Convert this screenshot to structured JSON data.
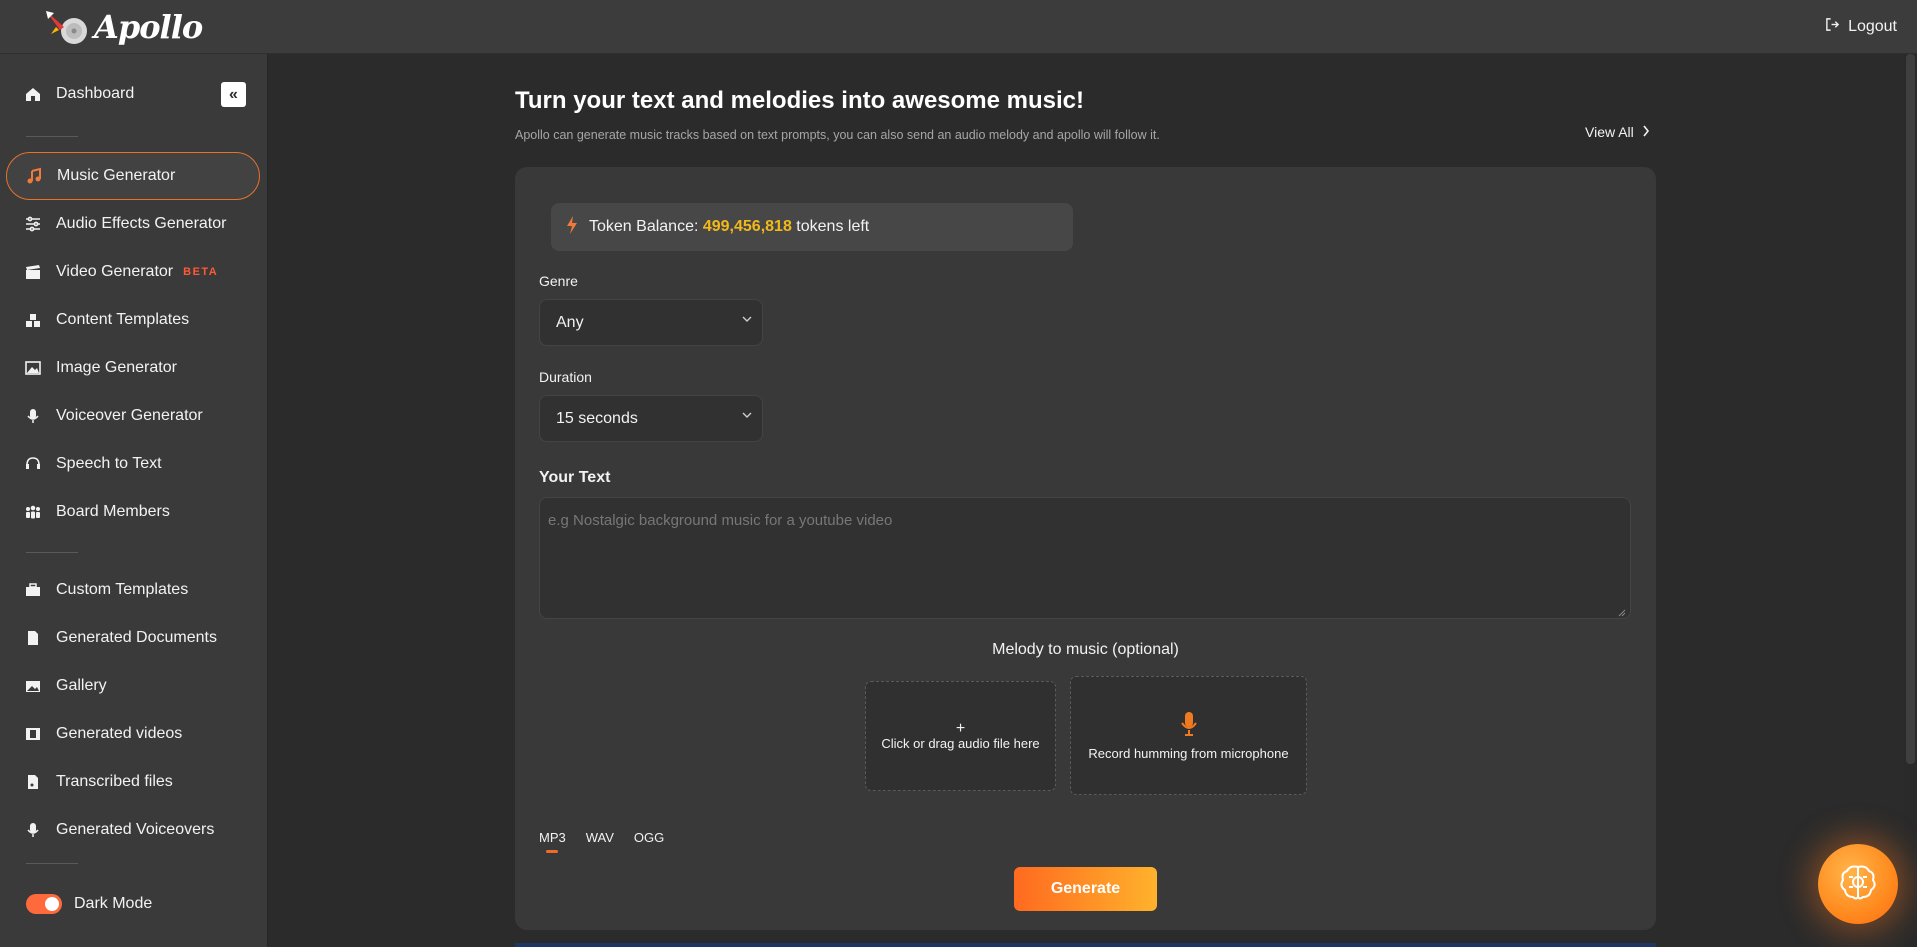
{
  "app": {
    "logo_text": "Apollo",
    "logout_label": "Logout"
  },
  "colors": {
    "accent": "#ff6a3d",
    "token_highlight": "#f2b91b",
    "beta": "#ff5a36",
    "background": "#2b2b2b"
  },
  "sidebar": {
    "collapse_glyph": "«",
    "items": [
      {
        "label": "Dashboard",
        "icon": "home-icon"
      },
      {
        "label": "Music Generator",
        "icon": "music-note-icon",
        "active": true
      },
      {
        "label": "Audio Effects Generator",
        "icon": "sliders-icon"
      },
      {
        "label": "Video Generator",
        "icon": "clapperboard-icon",
        "badge": "BETA"
      },
      {
        "label": "Content Templates",
        "icon": "blocks-icon"
      },
      {
        "label": "Image Generator",
        "icon": "image-icon"
      },
      {
        "label": "Voiceover Generator",
        "icon": "microphone-icon"
      },
      {
        "label": "Speech to Text",
        "icon": "headset-icon"
      },
      {
        "label": "Board Members",
        "icon": "people-icon"
      },
      {
        "label": "Custom Templates",
        "icon": "toolbox-icon"
      },
      {
        "label": "Generated Documents",
        "icon": "document-icon"
      },
      {
        "label": "Gallery",
        "icon": "picture-icon"
      },
      {
        "label": "Generated videos",
        "icon": "film-icon"
      },
      {
        "label": "Transcribed files",
        "icon": "file-audio-icon"
      },
      {
        "label": "Generated Voiceovers",
        "icon": "microphone-icon"
      }
    ],
    "dark_mode_label": "Dark Mode",
    "dark_mode_on": true
  },
  "main": {
    "title": "Turn your text and melodies into awesome music!",
    "subtitle": "Apollo can generate music tracks based on text prompts, you can also send an audio melody and apollo will follow it.",
    "view_all": "View All",
    "token_label": "Token Balance:",
    "token_value": "499,456,818",
    "token_suffix": "tokens left",
    "genre_label": "Genre",
    "genre_value": "Any",
    "duration_label": "Duration",
    "duration_value": "15 seconds",
    "text_label": "Your Text",
    "text_placeholder": "e.g Nostalgic background music for a youtube video",
    "melody_label": "Melody to music (optional)",
    "drop_plus": "+",
    "drop_label": "Click or drag audio file here",
    "record_label": "Record humming from microphone",
    "formats": [
      "MP3",
      "WAV",
      "OGG"
    ],
    "active_format": "MP3",
    "generate_label": "Generate"
  }
}
